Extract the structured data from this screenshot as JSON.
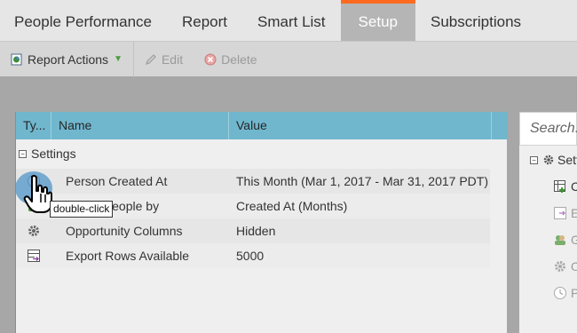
{
  "tabs": [
    {
      "label": "People Performance"
    },
    {
      "label": "Report"
    },
    {
      "label": "Smart List"
    },
    {
      "label": "Setup",
      "active": true
    },
    {
      "label": "Subscriptions"
    }
  ],
  "toolbar": {
    "report_actions": "Report Actions",
    "edit": "Edit",
    "delete": "Delete"
  },
  "grid": {
    "headers": {
      "type": "Ty...",
      "name": "Name",
      "value": "Value"
    },
    "group_label": "Settings",
    "rows": [
      {
        "icon": "clock-icon",
        "name": "Person Created At",
        "value": "This Month (Mar 1, 2017 - Mar 31, 2017 PDT)"
      },
      {
        "icon": "group-icon",
        "name": "Group People by",
        "value": "Created At (Months)"
      },
      {
        "icon": "gear-icon",
        "name": "Opportunity Columns",
        "value": "Hidden"
      },
      {
        "icon": "export-icon",
        "name": "Export Rows Available",
        "value": "5000"
      }
    ]
  },
  "right_panel": {
    "search_placeholder": "Search...",
    "tree_root": "Sett",
    "items": [
      {
        "icon": "add-column-icon",
        "label": "C"
      },
      {
        "icon": "export-icon",
        "label": "E"
      },
      {
        "icon": "group-icon",
        "label": "G"
      },
      {
        "icon": "gear-icon",
        "label": "O"
      },
      {
        "icon": "clock-icon",
        "label": "P"
      }
    ]
  },
  "cursor": {
    "tooltip": "double-click"
  },
  "colors": {
    "accent": "#ff6a1f",
    "grid_header": "#70b7ce"
  }
}
